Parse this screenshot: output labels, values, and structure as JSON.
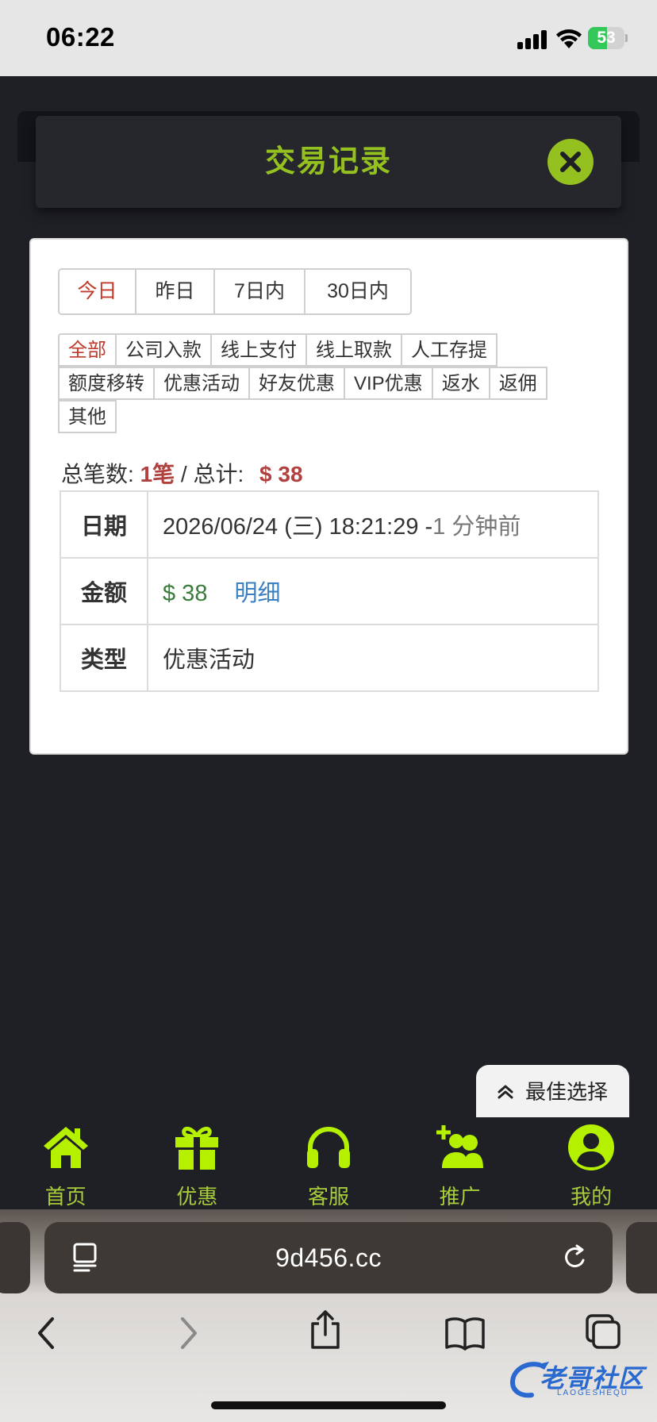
{
  "status_bar": {
    "time": "06:22",
    "battery": "53",
    "battery_level": 0.53
  },
  "modal": {
    "title": "交易记录"
  },
  "period_filters": [
    {
      "label": "今日",
      "active": true
    },
    {
      "label": "昨日",
      "active": false
    },
    {
      "label": "7日内",
      "active": false
    },
    {
      "label": "30日内",
      "active": false
    }
  ],
  "type_filters": [
    [
      "全部",
      "公司入款",
      "线上支付",
      "线上取款",
      "人工存提"
    ],
    [
      "额度移转",
      "优惠活动",
      "好友优惠",
      "VIP优惠",
      "返水",
      "返佣"
    ],
    [
      "其他"
    ]
  ],
  "active_type": "全部",
  "summary": {
    "count_label": "总笔数:",
    "count": "1笔",
    "sep": " / ",
    "total_label": "总计:",
    "total": "$ 38"
  },
  "record": {
    "date_label": "日期",
    "date": "2026/06/24 (三) 18:21:29 -",
    "ago": "1 分钟前",
    "amount_label": "金额",
    "amount": "$ 38",
    "detail_link": "明细",
    "type_label": "类型",
    "type": "优惠活动"
  },
  "best_choice": "最佳选择",
  "bottom_nav": [
    {
      "label": "首页",
      "icon": "home-icon"
    },
    {
      "label": "优惠",
      "icon": "gift-icon"
    },
    {
      "label": "客服",
      "icon": "headset-icon"
    },
    {
      "label": "推广",
      "icon": "add-user-icon"
    },
    {
      "label": "我的",
      "icon": "user-circle-icon"
    }
  ],
  "browser": {
    "url": "9d456.cc"
  },
  "watermark": {
    "text": "老哥社区",
    "sub": "LAOGESHEQU"
  },
  "colors": {
    "accent": "#94c11f",
    "nav_label": "#a8cc3a",
    "danger": "#b0413e",
    "amount": "#3a7d3a",
    "link": "#3a7fc0",
    "background": "#1f2026"
  }
}
